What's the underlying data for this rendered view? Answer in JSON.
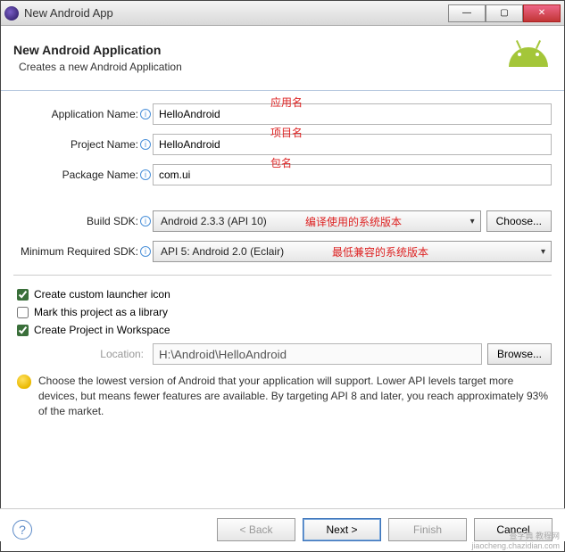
{
  "window": {
    "title": "New Android App"
  },
  "banner": {
    "heading": "New Android Application",
    "sub": "Creates a new Android Application"
  },
  "fields": {
    "appName": {
      "label": "Application Name:",
      "value": "HelloAndroid"
    },
    "projName": {
      "label": "Project Name:",
      "value": "HelloAndroid"
    },
    "pkgName": {
      "label": "Package Name:",
      "value": "com.ui"
    },
    "buildSdk": {
      "label": "Build SDK:",
      "value": "Android 2.3.3 (API 10)",
      "btn": "Choose..."
    },
    "minSdk": {
      "label": "Minimum Required SDK:",
      "value": "API 5: Android 2.0 (Eclair)"
    }
  },
  "annotations": {
    "appName": "应用名",
    "projName": "项目名",
    "pkgName": "包名",
    "buildSdk": "编译使用的系统版本",
    "minSdk": "最低兼容的系统版本"
  },
  "checks": {
    "launcher": "Create custom launcher icon",
    "library": "Mark this project as a library",
    "workspace": "Create Project in Workspace"
  },
  "location": {
    "label": "Location:",
    "value": "H:\\Android\\HelloAndroid",
    "btn": "Browse..."
  },
  "tip": "Choose the lowest version of Android that your application will support. Lower API levels target more devices, but means fewer features are available. By targeting API 8 and later, you reach approximately 93% of the market.",
  "buttons": {
    "back": "< Back",
    "next": "Next >",
    "finish": "Finish",
    "cancel": "Cancel"
  },
  "watermark": "查字典 教程网\njiaocheng.chazidian.com"
}
